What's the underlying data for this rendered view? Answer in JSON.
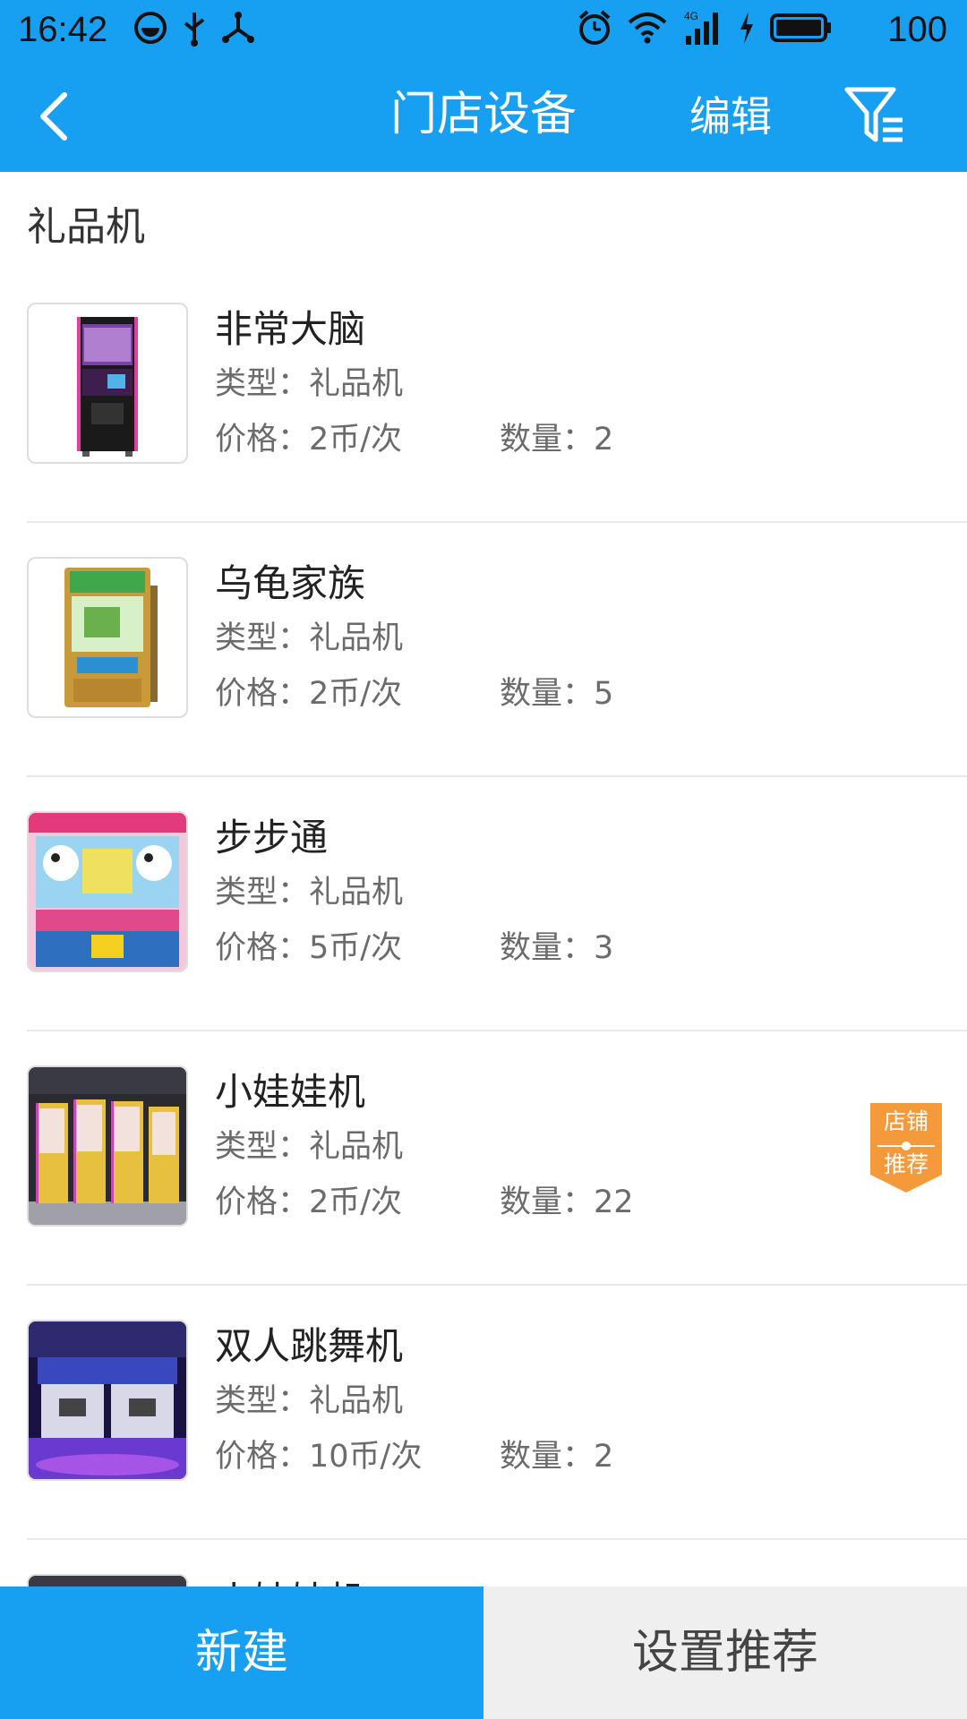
{
  "status_bar": {
    "time": "16:42",
    "battery_level": "100",
    "network": "4G",
    "left_icons": [
      "smiley-icon",
      "usb-icon",
      "share-icon"
    ],
    "right_icons": [
      "alarm-icon",
      "wifi-icon",
      "signal-icon",
      "charging-icon",
      "battery-icon"
    ]
  },
  "app_bar": {
    "title": "门店设备",
    "edit_label": "编辑",
    "back_icon": "back-arrow-icon",
    "filter_icon": "filter-icon",
    "background_color": "#17a0f2"
  },
  "section": {
    "title": "礼品机"
  },
  "items": [
    {
      "name": "非常大脑",
      "type": "类型：礼品机",
      "price": "价格：2币/次",
      "quantity": "数量：2",
      "recommended": false
    },
    {
      "name": "乌龟家族",
      "type": "类型：礼品机",
      "price": "价格：2币/次",
      "quantity": "数量：5",
      "recommended": false
    },
    {
      "name": "步步通",
      "type": "类型：礼品机",
      "price": "价格：5币/次",
      "quantity": "数量：3",
      "recommended": false
    },
    {
      "name": "小娃娃机",
      "type": "类型：礼品机",
      "price": "价格：2币/次",
      "quantity": "数量：22",
      "recommended": true
    },
    {
      "name": "双人跳舞机",
      "type": "类型：礼品机",
      "price": "价格：10币/次",
      "quantity": "数量：2",
      "recommended": false
    },
    {
      "name": "小娃娃机",
      "type": "",
      "price": "",
      "quantity": "",
      "recommended": false
    }
  ],
  "badge": {
    "line1": "店铺",
    "line2": "推荐",
    "color": "#f59a3a"
  },
  "bottom_bar": {
    "new_label": "新建",
    "set_recommend_label": "设置推荐",
    "new_color": "#17a0f2",
    "recommend_color": "#efefef"
  }
}
